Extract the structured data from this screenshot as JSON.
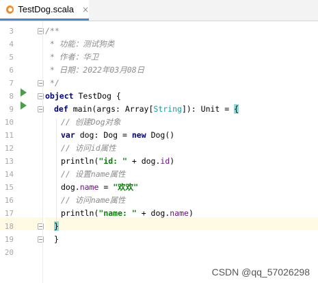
{
  "tab": {
    "label": "TestDog.scala",
    "close": "×",
    "icon": "scala-file-icon"
  },
  "line_numbers": [
    "3",
    "4",
    "5",
    "6",
    "7",
    "8",
    "9",
    "10",
    "11",
    "12",
    "13",
    "14",
    "15",
    "16",
    "17",
    "18",
    "19",
    "20"
  ],
  "code": {
    "l3": "/**",
    "l4": " * 功能：测试狗类",
    "l5": " * 作者：华卫",
    "l6": " * 日期：2022年03月08日",
    "l7": " */",
    "l8_kw": "object",
    "l8_rest": " TestDog {",
    "l9_kw": "def",
    "l9_a": " main(args: Array[",
    "l9_type": "String",
    "l9_b": "]): Unit = ",
    "l9_brace": "{",
    "l10": "// 创建Dog对象",
    "l11_kw1": "var",
    "l11_a": " dog: Dog = ",
    "l11_kw2": "new",
    "l11_b": " Dog()",
    "l12": "// 访问id属性",
    "l13_a": "println(",
    "l13_str": "\"id: \"",
    "l13_b": " + dog.",
    "l13_field": "id",
    "l13_c": ")",
    "l14": "// 设置name属性",
    "l15_a": "dog.",
    "l15_field": "name",
    "l15_b": " = ",
    "l15_str": "\"欢欢\"",
    "l16": "// 访问name属性",
    "l17_a": "println(",
    "l17_str": "\"name: \"",
    "l17_b": " + dog.",
    "l17_field": "name",
    "l17_c": ")",
    "l18": "}",
    "l19": "}"
  },
  "watermark": "CSDN @qq_57026298",
  "colors": {
    "keyword": "#000080",
    "string": "#008000",
    "comment": "#8c8c8c",
    "type": "#20999d",
    "field": "#660e7a",
    "current_line": "#fffae3",
    "run_icon": "#4e9a4e"
  }
}
